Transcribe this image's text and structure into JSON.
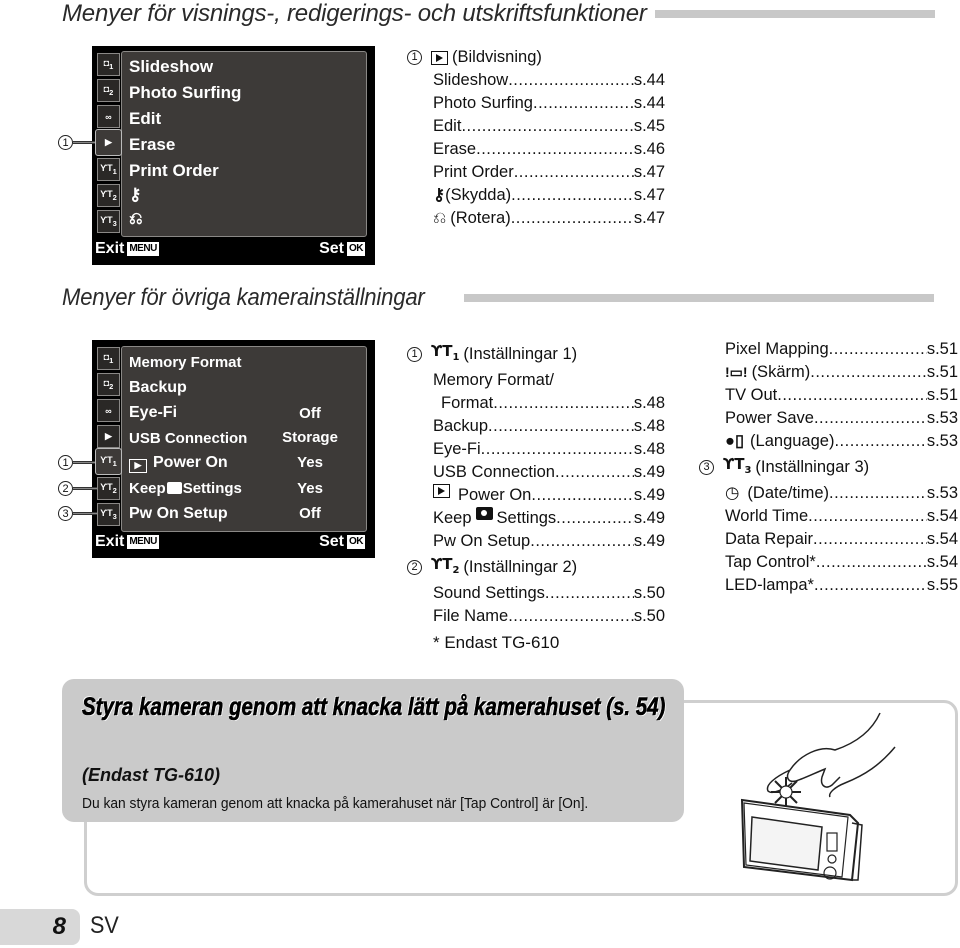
{
  "section1": {
    "title": "Menyer för visnings-, redigerings- och utskriftsfunktioner",
    "screen": {
      "tabs": [
        "camera1-tab",
        "camera2-tab",
        "movie-tab",
        "playback-tab",
        "setup1-tab",
        "setup2-tab",
        "setup3-tab"
      ],
      "tab_labels": [
        "1",
        "2",
        "",
        "",
        "1",
        "2",
        "3"
      ],
      "active_tab": "playback-tab",
      "items": [
        "Slideshow",
        "Photo Surfing",
        "Edit",
        "Erase",
        "Print Order",
        "protect-icon",
        "rotate-icon"
      ],
      "exit_label": "Exit",
      "exit_key": "MENU",
      "set_label": "Set",
      "set_key": "OK"
    },
    "callout": "1",
    "index": {
      "callout": "1",
      "heading": "(Bildvisning)",
      "heading_icon": "playback-icon",
      "rows": [
        {
          "label": "Slideshow",
          "page": "s.44"
        },
        {
          "label": "Photo Surfing",
          "page": "s.44"
        },
        {
          "label": "Edit",
          "page": "s.45"
        },
        {
          "label": "Erase",
          "page": "s.46"
        },
        {
          "label": "Print Order",
          "page": "s.47"
        },
        {
          "label": "(Skydda)",
          "icon": "protect-icon",
          "page": "s.47"
        },
        {
          "label": "(Rotera)",
          "icon": "rotate-icon",
          "page": "s.47"
        }
      ]
    }
  },
  "section2": {
    "title": "Menyer för övriga kamerainställningar",
    "screen": {
      "items": [
        {
          "label": "Memory Format",
          "value": ""
        },
        {
          "label": "Backup",
          "value": ""
        },
        {
          "label": "Eye-Fi",
          "value": "Off"
        },
        {
          "label": "USB Connection",
          "value": "Storage"
        },
        {
          "label": "Power On",
          "icon": "playback-icon",
          "value": "Yes"
        },
        {
          "label_a": "Keep",
          "label_b": "Settings",
          "icon": "camera-icon",
          "value": "Yes"
        },
        {
          "label": "Pw On Setup",
          "value": "Off"
        }
      ],
      "active_tab": "setup1-tab",
      "exit_label": "Exit",
      "exit_key": "MENU",
      "set_label": "Set",
      "set_key": "OK"
    },
    "callouts": [
      "1",
      "2",
      "3"
    ],
    "index_col1": {
      "group1": {
        "callout": "1",
        "heading": "(Inställningar 1)",
        "heading_icon": "setup1-icon",
        "rows": [
          {
            "label": "Memory Format/",
            "page": ""
          },
          {
            "label": " Format",
            "page": "s.48"
          },
          {
            "label": "Backup",
            "page": "s.48"
          },
          {
            "label": "Eye-Fi",
            "page": "s.48"
          },
          {
            "label": "USB Connection",
            "page": "s.49"
          },
          {
            "label": "Power On",
            "icon": "playback-icon",
            "page": "s.49"
          },
          {
            "label_a": "Keep",
            "label_b": "Settings",
            "icon": "camera-icon",
            "page": "s.49"
          },
          {
            "label": "Pw On Setup",
            "page": "s.49"
          }
        ]
      },
      "group2": {
        "callout": "2",
        "heading": "(Inställningar 2)",
        "heading_icon": "setup2-icon",
        "rows": [
          {
            "label": "Sound Settings",
            "page": "s.50"
          },
          {
            "label": "File Name",
            "page": "s.50"
          }
        ]
      }
    },
    "index_col2": {
      "rows_a": [
        {
          "label": "Pixel Mapping",
          "page": "s.51"
        },
        {
          "label": "(Skärm)",
          "icon": "monitor-icon",
          "page": "s.51"
        },
        {
          "label": "TV Out",
          "page": "s.51"
        },
        {
          "label": "Power Save",
          "page": "s.53"
        },
        {
          "label": "(Language)",
          "icon": "language-icon",
          "page": "s.53"
        }
      ],
      "group3": {
        "callout": "3",
        "heading": "(Inställningar 3)",
        "heading_icon": "setup3-icon",
        "rows": [
          {
            "label": "(Date/time)",
            "icon": "clock-icon",
            "page": "s.53"
          },
          {
            "label": "World Time",
            "page": "s.54"
          },
          {
            "label": "Data Repair",
            "page": "s.54"
          },
          {
            "label": "Tap Control*",
            "page": "s.54"
          },
          {
            "label": "LED-lampa*",
            "page": "s.55"
          }
        ]
      }
    },
    "footnote": "* Endast TG-610"
  },
  "tap_box": {
    "title": "Styra kameran genom att knacka lätt på kamerahuset (s. 54)",
    "subtitle": "(Endast TG-610)",
    "description": "Du kan styra kameran genom att knacka på kamerahuset när [Tap Control] är [On].",
    "illustration": "hand-tapping-camera-illustration"
  },
  "footer": {
    "page_number": "8",
    "language": "SV"
  }
}
